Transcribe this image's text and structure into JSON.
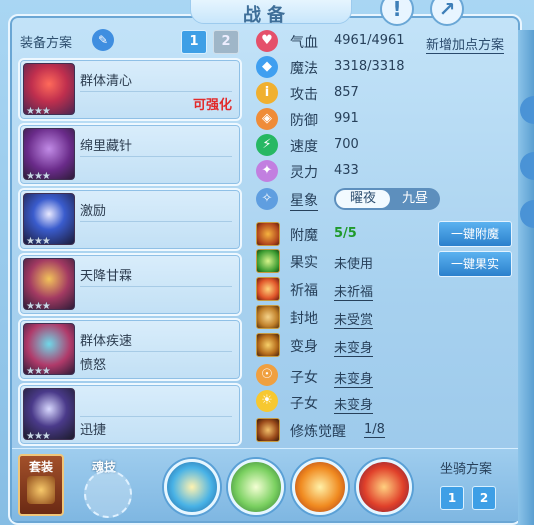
{
  "window": {
    "title": "战备"
  },
  "equip_plan": {
    "label": "装备方案",
    "tabs": [
      "1",
      "2"
    ]
  },
  "skills": [
    {
      "name": "群体清心",
      "sub": "",
      "badge": "可强化",
      "stars": "★★★"
    },
    {
      "name": "绵里藏针",
      "sub": "",
      "badge": "",
      "stars": "★★★"
    },
    {
      "name": "激励",
      "sub": "",
      "badge": "",
      "stars": "★★★"
    },
    {
      "name": "天降甘霖",
      "sub": "",
      "badge": "",
      "stars": "★★★"
    },
    {
      "name": "群体疾速",
      "sub": "愤怒",
      "badge": "",
      "stars": "★★★"
    },
    {
      "name": "",
      "sub": "迅捷",
      "badge": "",
      "stars": "★★★"
    }
  ],
  "add_plan_label": "新增加点方案",
  "stats": [
    {
      "label": "气血",
      "value": "4961/4961",
      "color": "#e5506a",
      "icon": "heart-icon",
      "glyph": "♥"
    },
    {
      "label": "魔法",
      "value": "3318/3318",
      "color": "#3f9ff0",
      "icon": "mana-icon",
      "glyph": "◆"
    },
    {
      "label": "攻击",
      "value": "857",
      "color": "#f0b030",
      "icon": "attack-icon",
      "glyph": "i"
    },
    {
      "label": "防御",
      "value": "991",
      "color": "#ef8c38",
      "icon": "defense-icon",
      "glyph": "◈"
    },
    {
      "label": "速度",
      "value": "700",
      "color": "#27b863",
      "icon": "speed-icon",
      "glyph": "⚡"
    },
    {
      "label": "灵力",
      "value": "433",
      "color": "#c27fe0",
      "icon": "spirit-icon",
      "glyph": "✦"
    }
  ],
  "constellation": {
    "label": "星象",
    "options": [
      "曜夜",
      "九昼"
    ]
  },
  "functions": [
    {
      "label": "附魔",
      "value": "5/5",
      "kind": "green",
      "icon": "enchant-icon"
    },
    {
      "label": "果实",
      "value": "未使用",
      "kind": "plain",
      "icon": "fruit-icon"
    },
    {
      "label": "祈福",
      "value": "未祈福",
      "kind": "link",
      "icon": "blessing-icon"
    },
    {
      "label": "封地",
      "value": "未受赏",
      "kind": "link",
      "icon": "fief-icon"
    },
    {
      "label": "变身",
      "value": "未变身",
      "kind": "link",
      "icon": "transform-icon"
    },
    {
      "label": "子女",
      "value": "未变身",
      "kind": "link",
      "icon": "child-icon"
    },
    {
      "label": "子女",
      "value": "未变身",
      "kind": "link",
      "icon": "child-icon-2"
    },
    {
      "label": "修炼觉醒",
      "value": "1/8",
      "kind": "link",
      "icon": "cultivation-icon"
    }
  ],
  "buttons": {
    "enchant_all": "一键附魔",
    "fruit_all": "一键果实"
  },
  "bottom": {
    "suit_label": "套装",
    "soul_label": "魂技",
    "mount_title": "坐骑方案",
    "mount_tabs": [
      "1",
      "2"
    ]
  }
}
